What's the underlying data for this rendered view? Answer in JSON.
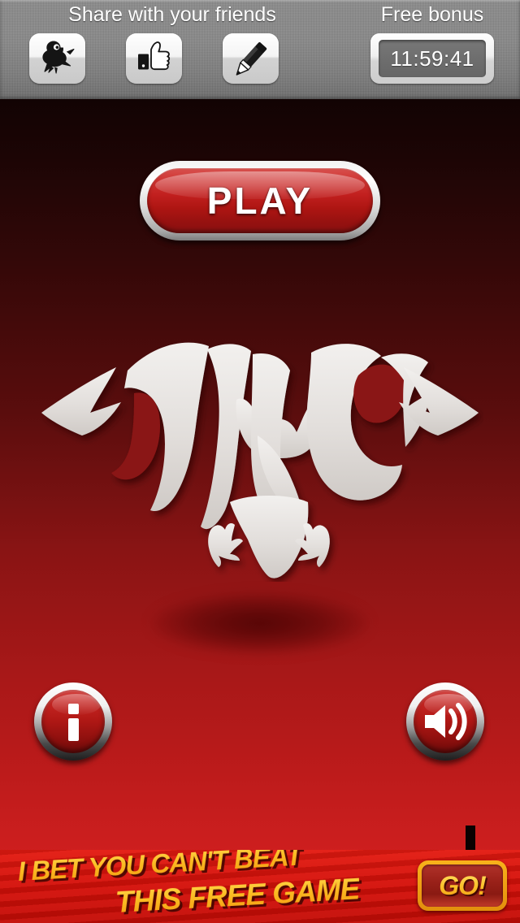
{
  "header": {
    "share_title": "Share with your friends",
    "bonus_title": "Free bonus",
    "timer_value": "11:59:41",
    "share_buttons": [
      {
        "name": "twitter-share",
        "icon": "bird-icon",
        "label": "Twitter"
      },
      {
        "name": "facebook-share",
        "icon": "thumbs-up-icon",
        "label": "Facebook"
      },
      {
        "name": "compose-share",
        "icon": "pencil-icon",
        "label": "Compose"
      }
    ]
  },
  "main": {
    "play_label": "PLAY",
    "logo_alt": "DINO bat logo",
    "info_label": "i",
    "sound_label": "Sound on"
  },
  "ad": {
    "line1": "I BET YOU CAN'T BEAT",
    "line2": "THIS FREE GAME",
    "go_label": "GO!"
  },
  "colors": {
    "brand_red": "#c11f1e",
    "bg_top": "#120303",
    "bg_bottom": "#d32121",
    "header_gray": "#8a8a8a",
    "ad_red": "#d41009",
    "ad_yellow": "#fbbc23",
    "logo_silver": "#e6e3e0"
  }
}
